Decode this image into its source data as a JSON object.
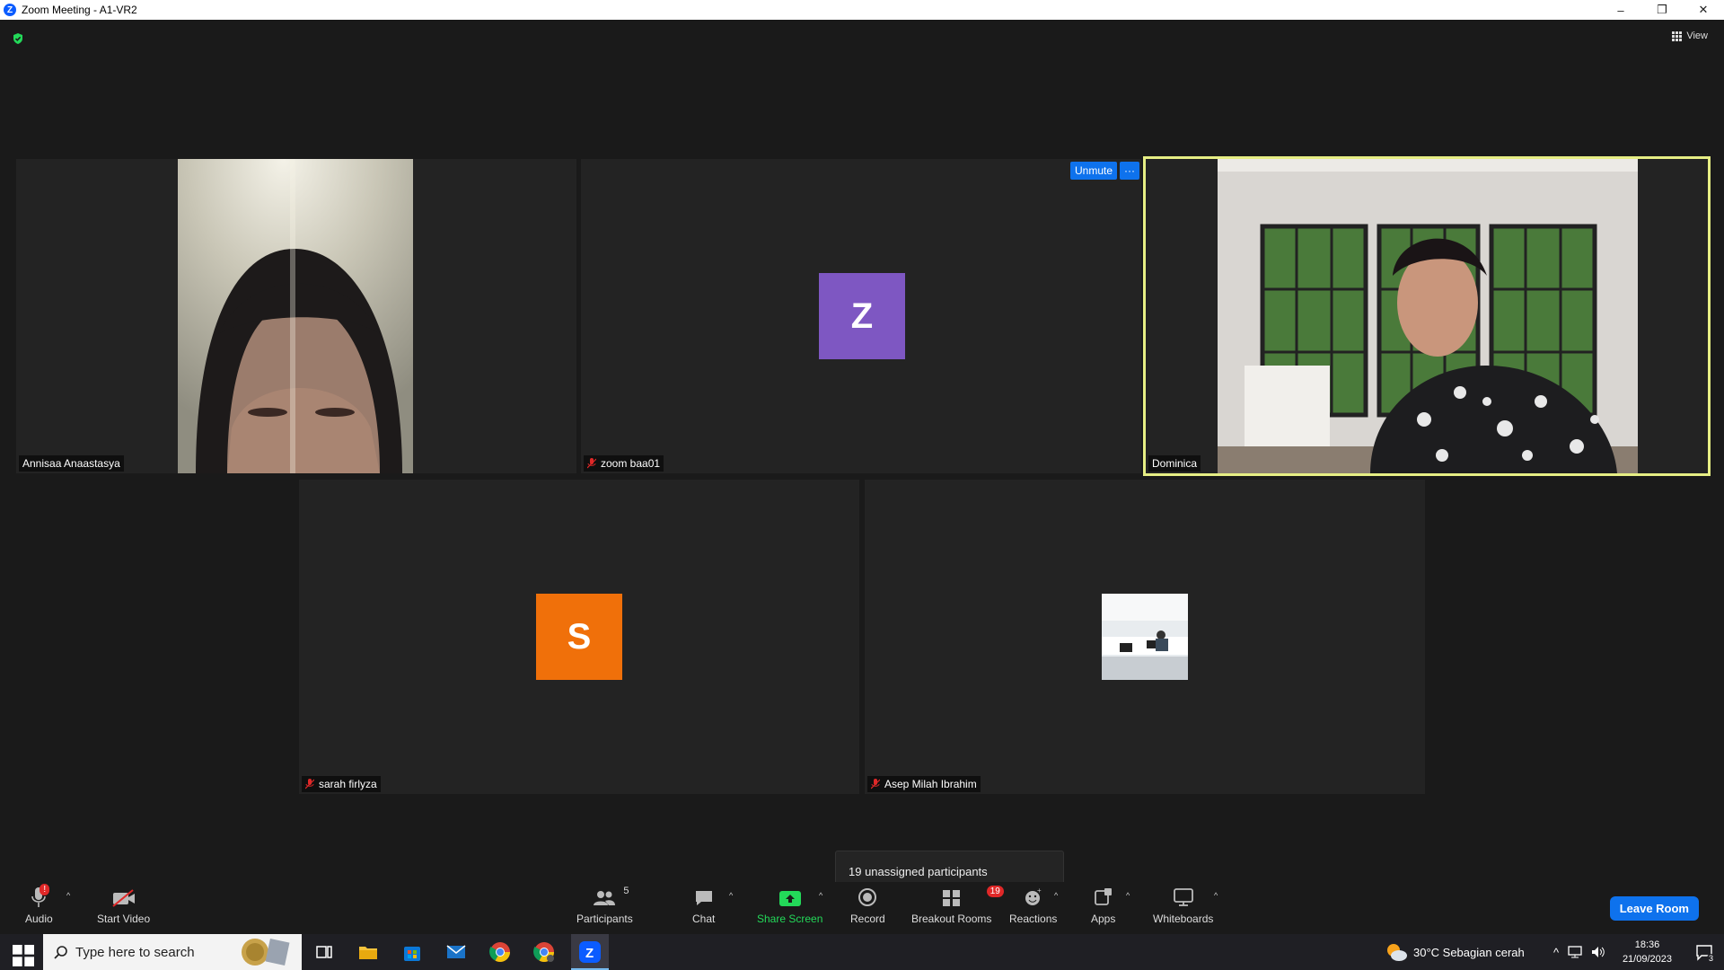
{
  "window": {
    "title": "Zoom Meeting - A1-VR2",
    "minimize": "–",
    "restore": "❐",
    "close": "✕"
  },
  "view_label": "View",
  "tiles": [
    {
      "name": "Annisaa Anaastasya"
    },
    {
      "name": "zoom baa01",
      "initial": "Z",
      "color": "#7e57c2"
    },
    {
      "name": "Dominica"
    },
    {
      "name": "sarah firlyza",
      "initial": "S",
      "color": "#f0700a"
    },
    {
      "name": "Asep Milah Ibrahim"
    }
  ],
  "unmute": {
    "label": "Unmute",
    "more": "···"
  },
  "tooltip": "19 unassigned participants",
  "toolbar": {
    "audio": "Audio",
    "audio_badge": "!",
    "start_video": "Start Video",
    "participants": "Participants",
    "participants_count": "5",
    "chat": "Chat",
    "share_screen": "Share Screen",
    "record": "Record",
    "breakout_rooms": "Breakout Rooms",
    "breakout_badge": "19",
    "reactions": "Reactions",
    "apps": "Apps",
    "whiteboards": "Whiteboards",
    "leave": "Leave Room"
  },
  "taskbar": {
    "search_placeholder": "Type here to search",
    "weather": "30°C  Sebagian cerah",
    "time": "18:36",
    "date": "21/09/2023",
    "notif_count": "3"
  }
}
